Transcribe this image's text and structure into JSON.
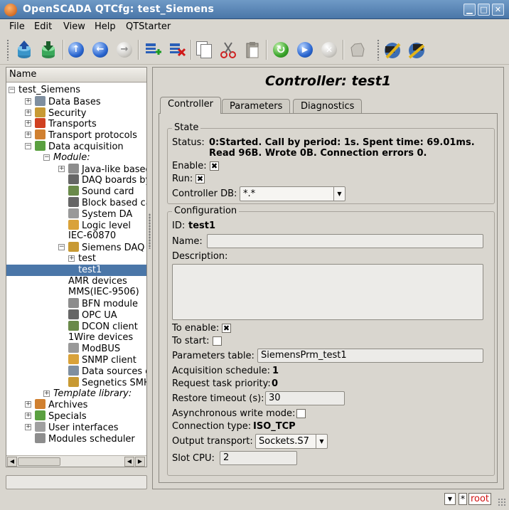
{
  "window": {
    "title": "OpenSCADA QTCfg: test_Siemens",
    "min": "▁",
    "max": "□",
    "close": "✕"
  },
  "menu": [
    "File",
    "Edit",
    "View",
    "Help",
    "QTStarter"
  ],
  "tree": {
    "header": "Name",
    "rows": [
      {
        "label": "test_Siemens",
        "indent": 0,
        "exp": "−"
      },
      {
        "label": "Data Bases",
        "indent": 1,
        "exp": "+"
      },
      {
        "label": "Security",
        "indent": 1,
        "exp": "+"
      },
      {
        "label": "Transports",
        "indent": 1,
        "exp": "+"
      },
      {
        "label": "Transport protocols",
        "indent": 1,
        "exp": "+"
      },
      {
        "label": "Data acquisition",
        "indent": 1,
        "exp": "−"
      },
      {
        "label": "Module:",
        "indent": 2,
        "exp": "−",
        "italic": true
      },
      {
        "label": "Java-like based",
        "indent": 3,
        "exp": "+"
      },
      {
        "label": "DAQ boards by",
        "indent": 3
      },
      {
        "label": "Sound card",
        "indent": 3
      },
      {
        "label": "Block based ca",
        "indent": 3
      },
      {
        "label": "System DA",
        "indent": 3
      },
      {
        "label": "Logic level",
        "indent": 3
      },
      {
        "label": "IEC-60870",
        "indent": 3
      },
      {
        "label": "Siemens DAQ",
        "indent": 3,
        "exp": "−"
      },
      {
        "label": "test",
        "indent": 4,
        "exp": "+"
      },
      {
        "label": "test1",
        "indent": 4,
        "exp": "+",
        "selected": true
      },
      {
        "label": "AMR devices",
        "indent": 3
      },
      {
        "label": "MMS(IEC-9506)",
        "indent": 3
      },
      {
        "label": "BFN module",
        "indent": 3
      },
      {
        "label": "OPC UA",
        "indent": 3
      },
      {
        "label": "DCON client",
        "indent": 3
      },
      {
        "label": "1Wire devices",
        "indent": 3
      },
      {
        "label": "ModBUS",
        "indent": 3
      },
      {
        "label": "SNMP client",
        "indent": 3
      },
      {
        "label": "Data sources g",
        "indent": 3
      },
      {
        "label": "Segnetics SMH",
        "indent": 3
      },
      {
        "label": "Template library:",
        "indent": 2,
        "exp": "+",
        "italic": true
      },
      {
        "label": "Archives",
        "indent": 1,
        "exp": "+"
      },
      {
        "label": "Specials",
        "indent": 1,
        "exp": "+"
      },
      {
        "label": "User interfaces",
        "indent": 1,
        "exp": "+"
      },
      {
        "label": "Modules scheduler",
        "indent": 1
      }
    ]
  },
  "page": {
    "title": "Controller: test1",
    "tabs": [
      "Controller",
      "Parameters",
      "Diagnostics"
    ],
    "state": {
      "legend": "State",
      "status_label": "Status:",
      "status_line1": "0:Started. Call by period: 1s. Spent time: 69.01ms.",
      "status_line2": "Read 96B. Wrote 0B. Connection errors 0.",
      "enable_label": "Enable:",
      "enable_mark": "✖",
      "run_label": "Run:",
      "run_mark": "✖",
      "db_label": "Controller DB:",
      "db_value": "*.*"
    },
    "config": {
      "legend": "Configuration",
      "id_label": "ID:",
      "id_value": "test1",
      "name_label": "Name:",
      "name_value": "",
      "desc_label": "Description:",
      "to_enable_label": "To enable:",
      "to_enable_mark": "✖",
      "to_start_label": "To start:",
      "to_start_mark": "",
      "prm_table_label": "Parameters table:",
      "prm_table_value": "SiemensPrm_test1",
      "schedule_label": "Acquisition schedule:",
      "schedule_value": "1",
      "priority_label": "Request task priority:",
      "priority_value": "0",
      "restore_label": "Restore timeout (s):",
      "restore_value": "30",
      "async_label": "Asynchronous write mode:",
      "async_mark": "",
      "conn_label": "Connection type:",
      "conn_value": "ISO_TCP",
      "out_label": "Output transport:",
      "out_value": "Sockets.S7",
      "slot_label": "Slot CPU:",
      "slot_value": "2"
    }
  },
  "status": {
    "star": "*",
    "user": "root"
  }
}
